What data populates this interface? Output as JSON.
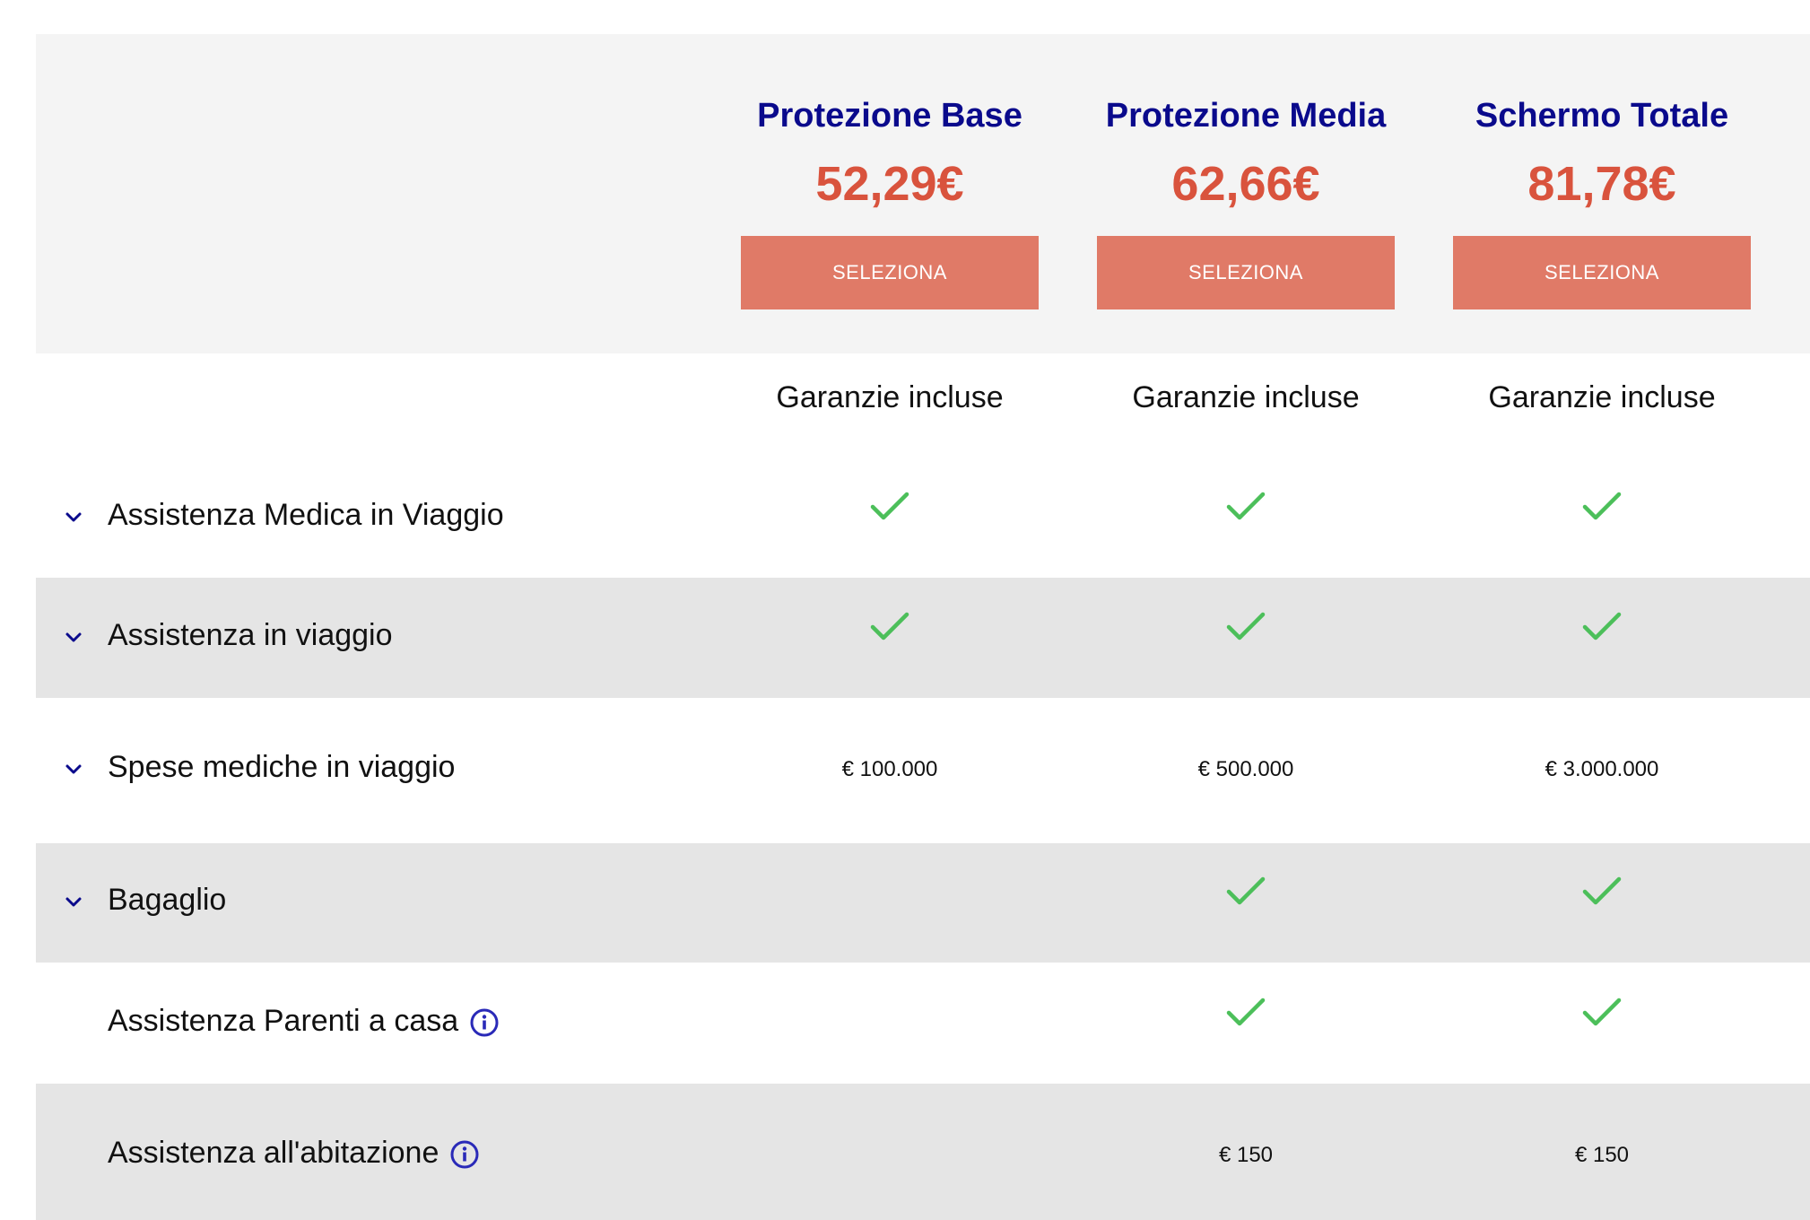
{
  "plans": [
    {
      "name": "Protezione Base",
      "price": "52,29€",
      "button_label": "SELEZIONA",
      "included_label": "Garanzie incluse"
    },
    {
      "name": "Protezione Media",
      "price": "62,66€",
      "button_label": "SELEZIONA",
      "included_label": "Garanzie incluse"
    },
    {
      "name": "Schermo Totale",
      "price": "81,78€",
      "button_label": "SELEZIONA",
      "included_label": "Garanzie incluse"
    }
  ],
  "rows": [
    {
      "label": "Assistenza Medica in Viaggio",
      "expandable": true,
      "info": false,
      "values": [
        "check",
        "check",
        "check"
      ]
    },
    {
      "label": "Assistenza in viaggio",
      "expandable": true,
      "info": false,
      "values": [
        "check",
        "check",
        "check"
      ]
    },
    {
      "label": "Spese mediche in viaggio",
      "expandable": true,
      "info": false,
      "values": [
        "€ 100.000",
        "€ 500.000",
        "€ 3.000.000"
      ]
    },
    {
      "label": "Bagaglio",
      "expandable": true,
      "info": false,
      "values": [
        "",
        "check",
        "check"
      ]
    },
    {
      "label": "Assistenza Parenti a casa",
      "expandable": false,
      "info": true,
      "values": [
        "",
        "check",
        "check"
      ]
    },
    {
      "label": "Assistenza all'abitazione",
      "expandable": false,
      "info": true,
      "values": [
        "",
        "€ 150",
        "€ 150"
      ]
    }
  ],
  "colors": {
    "plan_name": "#0a0a8c",
    "price": "#d9533d",
    "button": "#e07a67",
    "check": "#4cbf5a",
    "chevron": "#0a0a8c",
    "info": "#2a2ab8",
    "header_bg": "#f4f4f4",
    "row_shade": "#e5e5e5"
  },
  "icons": {
    "chevron": "chevron-down-icon",
    "check": "checkmark-icon",
    "info": "info-icon"
  }
}
